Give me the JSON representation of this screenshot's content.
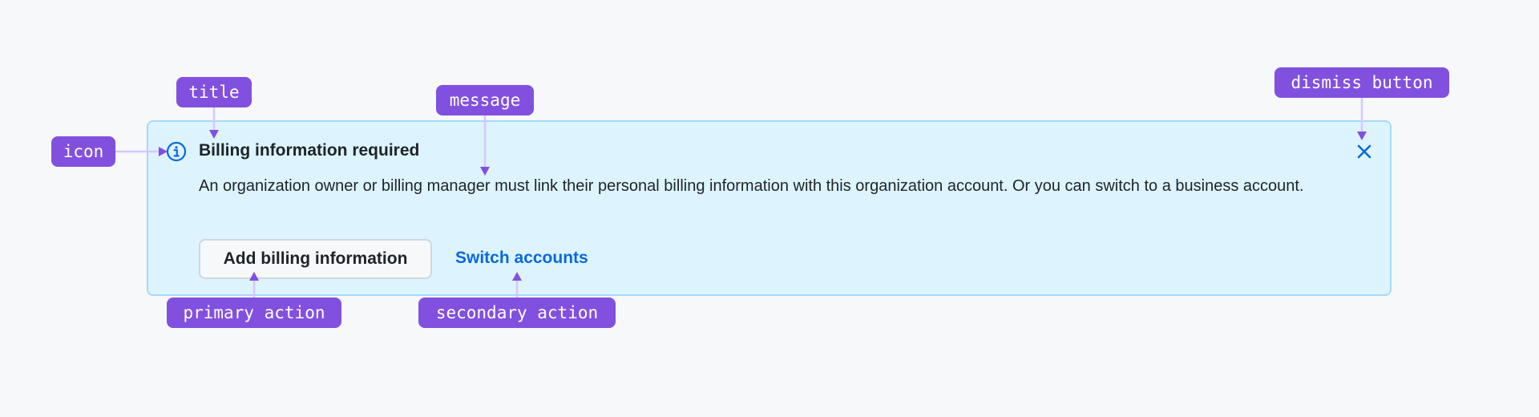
{
  "banner": {
    "icon": "info-circle-icon",
    "title": "Billing information required",
    "message": "An organization owner or billing manager must link their personal billing information with this organization account. Or you can switch to a business account.",
    "primary_action_label": "Add billing information",
    "secondary_action_label": "Switch accounts",
    "dismiss_icon": "close-icon"
  },
  "annotations": {
    "title": "title",
    "message": "message",
    "dismiss": "dismiss button",
    "icon": "icon",
    "primary": "primary action",
    "secondary": "secondary action"
  },
  "colors": {
    "page_background": "#f6f8fa",
    "banner_background": "#ddf4ff",
    "banner_border": "#a5d9fb",
    "accent_blue": "#0969da",
    "annotation_purple": "#8250df",
    "connector_lavender": "#d8c6ff"
  }
}
